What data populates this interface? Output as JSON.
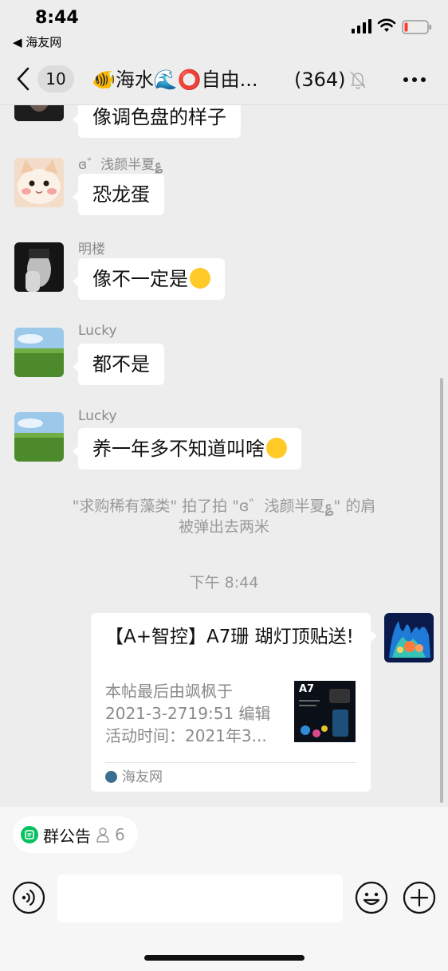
{
  "status_bar": {
    "time": "8:44",
    "back_app": "◀ 海友网"
  },
  "nav": {
    "unread_count": "10",
    "title": "🐠海水🌊⭕自由...",
    "member_count": "(364)",
    "icons": [
      "chevron-left-icon",
      "mute-bell-icon",
      "more-icon"
    ]
  },
  "messages": [
    {
      "sender": "",
      "text": "像调色盘的样子",
      "avatar": "dark-portrait"
    },
    {
      "sender": "ɞ゛浅颜半夏ּ؏",
      "text": "恐龙蛋",
      "avatar": "cat"
    },
    {
      "sender": "明楼",
      "text": "像不一定是",
      "emoji": "grinning-sweat-emoji",
      "avatar": "face-hand"
    },
    {
      "sender": "Lucky",
      "text": "都不是",
      "avatar": "green-field"
    },
    {
      "sender": "Lucky",
      "text": "养一年多不知道叫啥",
      "emoji": "crying-emoji",
      "avatar": "green-field"
    }
  ],
  "system_message": {
    "line1": "\"求购稀有藻类\" 拍了拍 \"ɞ゛浅颜半夏ּ؏\" 的肩",
    "line2": "被弹出去两米"
  },
  "time_divider": "下午 8:44",
  "card": {
    "title": "【A+智控】A7珊 瑚灯顶贴送!",
    "desc_lines": [
      "本帖最后由飒枫于",
      "2021-3-2719:51 编辑",
      "活动时间：2021年3..."
    ],
    "thumb_label": "A7",
    "source": "海友网"
  },
  "bottom": {
    "notice_label": "群公告",
    "notice_count": "6"
  },
  "colors": {
    "background": "#ededed",
    "bubble": "#ffffff",
    "accent_green": "#07c160",
    "meta_gray": "#8a8a8a"
  }
}
